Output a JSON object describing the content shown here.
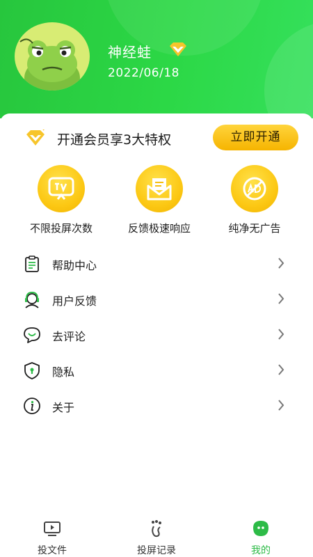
{
  "profile": {
    "username": "神经蛙",
    "date": "2022/06/18",
    "avatar_icon": "frog-avatar-icon"
  },
  "vip": {
    "promo_text": "开通会员享3大特权",
    "button_label": "立即开通",
    "icon": "diamond-icon"
  },
  "perks": [
    {
      "label": "不限投屏次数",
      "icon": "tv-cast-icon"
    },
    {
      "label": "反馈极速响应",
      "icon": "envelope-icon"
    },
    {
      "label": "纯净无广告",
      "icon": "no-ad-icon"
    }
  ],
  "menu": [
    {
      "label": "帮助中心",
      "icon": "clipboard-icon"
    },
    {
      "label": "用户反馈",
      "icon": "headset-icon"
    },
    {
      "label": "去评论",
      "icon": "chat-bubble-icon"
    },
    {
      "label": "隐私",
      "icon": "shield-icon"
    },
    {
      "label": "关于",
      "icon": "info-icon"
    }
  ],
  "tabbar": {
    "tabs": [
      {
        "label": "投文件",
        "icon": "play-screen-icon"
      },
      {
        "label": "投屏记录",
        "icon": "footprint-icon"
      },
      {
        "label": "我的",
        "icon": "profile-face-icon"
      }
    ],
    "active_index": 2
  },
  "colors": {
    "brand_green": "#2cd846",
    "vip_gold": "#f6b400",
    "active_tab": "#2dbb47"
  }
}
